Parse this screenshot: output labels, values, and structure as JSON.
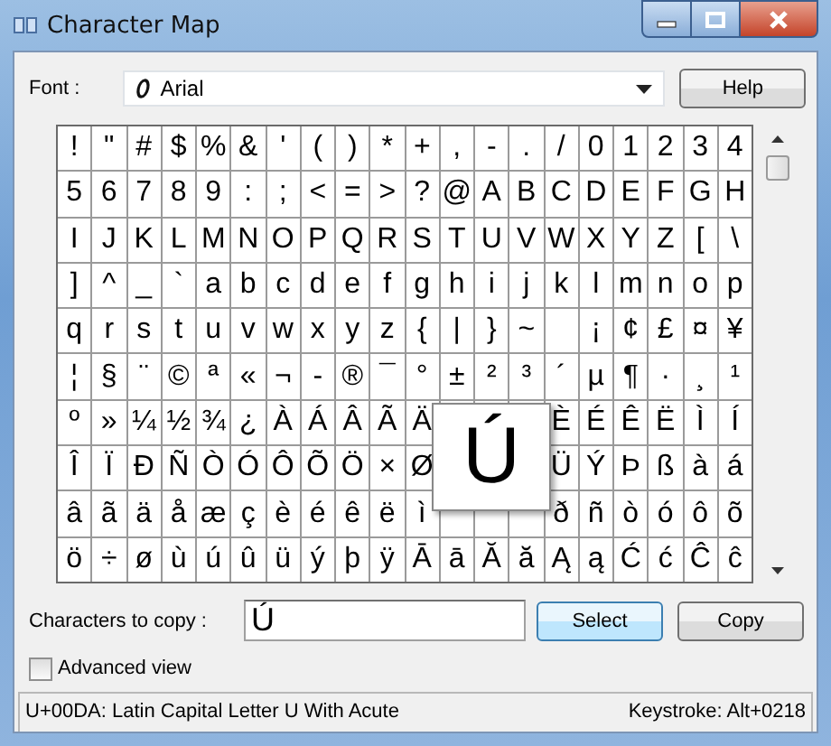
{
  "window": {
    "title": "Character Map"
  },
  "font": {
    "label": "Font :",
    "value": "Arial"
  },
  "help_button": "Help",
  "grid": {
    "rows": [
      [
        "!",
        "\"",
        "#",
        "$",
        "%",
        "&",
        "'",
        "(",
        ")",
        "*",
        "+",
        ",",
        "-",
        ".",
        "/",
        "0",
        "1",
        "2",
        "3",
        "4"
      ],
      [
        "5",
        "6",
        "7",
        "8",
        "9",
        ":",
        ";",
        "<",
        "=",
        ">",
        "?",
        "@",
        "A",
        "B",
        "C",
        "D",
        "E",
        "F",
        "G",
        "H"
      ],
      [
        "I",
        "J",
        "K",
        "L",
        "M",
        "N",
        "O",
        "P",
        "Q",
        "R",
        "S",
        "T",
        "U",
        "V",
        "W",
        "X",
        "Y",
        "Z",
        "[",
        "\\"
      ],
      [
        "]",
        "^",
        "_",
        "`",
        "a",
        "b",
        "c",
        "d",
        "e",
        "f",
        "g",
        "h",
        "i",
        "j",
        "k",
        "l",
        "m",
        "n",
        "o",
        "p"
      ],
      [
        "q",
        "r",
        "s",
        "t",
        "u",
        "v",
        "w",
        "x",
        "y",
        "z",
        "{",
        "|",
        "}",
        "~",
        null,
        "¡",
        "¢",
        "£",
        "¤",
        "¥"
      ],
      [
        "¦",
        "§",
        "¨",
        "©",
        "ª",
        "«",
        "¬",
        "-",
        "®",
        "¯",
        "°",
        "±",
        "²",
        "³",
        "´",
        "µ",
        "¶",
        "·",
        "¸",
        "¹"
      ],
      [
        "º",
        "»",
        "¼",
        "½",
        "¾",
        "¿",
        "À",
        "Á",
        "Â",
        "Ã",
        "Ä",
        null,
        null,
        null,
        "È",
        "É",
        "Ê",
        "Ë",
        "Ì",
        "Í"
      ],
      [
        "Î",
        "Ï",
        "Ð",
        "Ñ",
        "Ò",
        "Ó",
        "Ô",
        "Õ",
        "Ö",
        "×",
        "Ø",
        null,
        null,
        null,
        "Ü",
        "Ý",
        "Þ",
        "ß",
        "à",
        "á"
      ],
      [
        "â",
        "ã",
        "ä",
        "å",
        "æ",
        "ç",
        "è",
        "é",
        "ê",
        "ë",
        "ì",
        null,
        null,
        null,
        "ð",
        "ñ",
        "ò",
        "ó",
        "ô",
        "õ"
      ],
      [
        "ö",
        "÷",
        "ø",
        "ù",
        "ú",
        "û",
        "ü",
        "ý",
        "þ",
        "ÿ",
        "Ā",
        "ā",
        "Ă",
        "ă",
        "Ą",
        "ą",
        "Ć",
        "ć",
        "Ĉ",
        "ĉ"
      ]
    ]
  },
  "magnifier": {
    "char": "Ú"
  },
  "copy_field": {
    "label": "Characters to copy :",
    "value": "Ú"
  },
  "select_button": "Select",
  "copy_button": "Copy",
  "advanced_view": {
    "label": "Advanced view",
    "checked": false
  },
  "status_bar": {
    "description": "U+00DA: Latin Capital Letter U With Acute",
    "keystroke": "Keystroke: Alt+0218"
  }
}
